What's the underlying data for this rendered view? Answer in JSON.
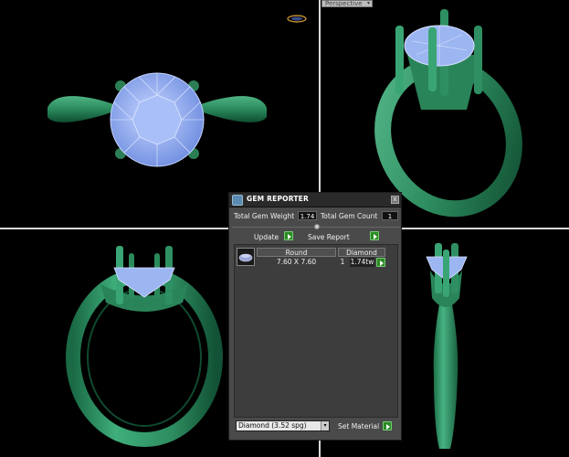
{
  "viewport": {
    "view_mode": "Perspective"
  },
  "gem_reporter": {
    "title": "GEM REPORTER",
    "close_label": "x",
    "total_gem_weight_label": "Total Gem Weight",
    "total_gem_weight_value": "1.74",
    "total_gem_count_label": "Total Gem Count",
    "total_gem_count_value": "1",
    "update_label": "Update",
    "save_report_label": "Save Report",
    "gems": [
      {
        "shape": "Round",
        "size": "7.60 X 7.60",
        "material": "Diamond",
        "count": "1",
        "weight": "1.74tw"
      }
    ],
    "material_select_value": "Diamond    (3.52 spg)",
    "set_material_label": "Set Material"
  },
  "colors": {
    "ring_metal": "#2e8a5e",
    "gem": "#9ab4f0",
    "background": "#000000",
    "accent_button": "#2a8a22"
  }
}
